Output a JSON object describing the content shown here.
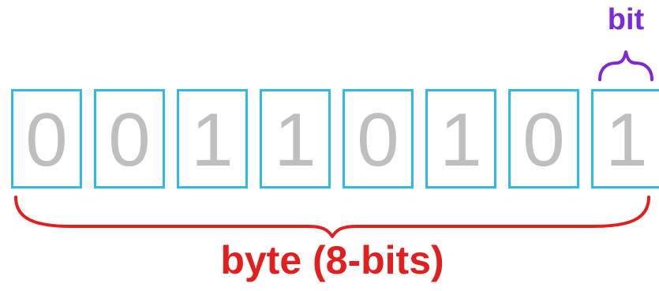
{
  "bits": [
    "0",
    "0",
    "1",
    "1",
    "0",
    "1",
    "0",
    "1"
  ],
  "labels": {
    "bit": "bit",
    "byte": "byte (8-bits)"
  },
  "colors": {
    "cell_border": "#2ebbe6",
    "bit_text": "#bfbfbf",
    "bit_label": "#7a2bd6",
    "byte_label": "#e0201f"
  }
}
